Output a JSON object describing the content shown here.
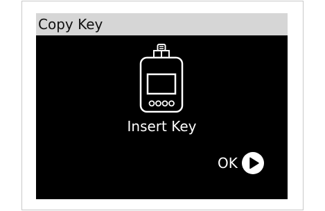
{
  "window": {
    "title": "Copy Key"
  },
  "main": {
    "device_icon": "key-reader-icon",
    "message": "Insert Key"
  },
  "actions": {
    "ok_label": "OK",
    "ok_icon": "play-circle-icon"
  },
  "colors": {
    "titlebar_bg": "#d6d6d6",
    "screen_bg": "#000000",
    "text_light": "#ffffff",
    "title_text": "#111111"
  }
}
